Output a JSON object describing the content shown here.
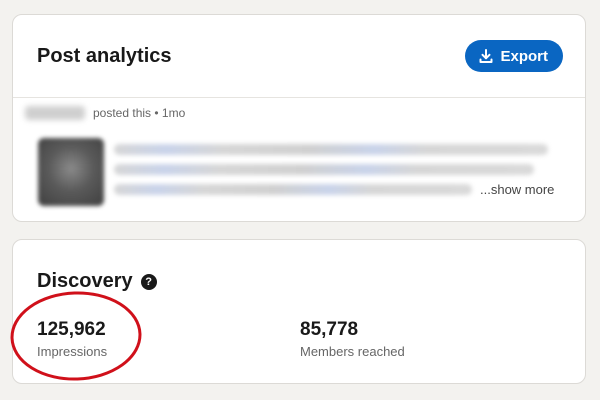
{
  "analytics": {
    "title": "Post analytics",
    "export_label": "Export",
    "post": {
      "posted_meta": "posted this • 1mo",
      "show_more": "...show more"
    }
  },
  "discovery": {
    "title": "Discovery",
    "help_glyph": "?",
    "metrics": [
      {
        "value": "125,962",
        "label": "Impressions"
      },
      {
        "value": "85,778",
        "label": "Members reached"
      }
    ]
  },
  "colors": {
    "accent": "#0a66c2",
    "annotation": "#d0101a",
    "background": "#f3f2ef"
  },
  "icons": {
    "export": "download-arrow-icon",
    "help": "question-circle-icon"
  }
}
